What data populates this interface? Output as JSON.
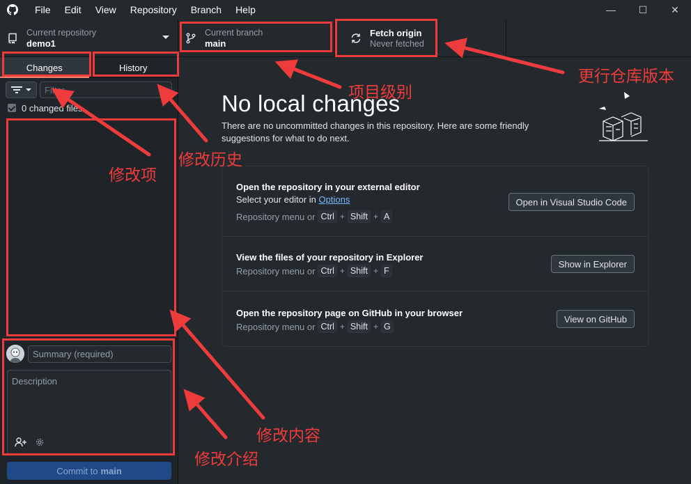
{
  "menu": [
    "File",
    "Edit",
    "View",
    "Repository",
    "Branch",
    "Help"
  ],
  "window_controls": {
    "minimize": "—",
    "maximize": "☐",
    "close": "✕"
  },
  "toolbar": {
    "repo_label": "Current repository",
    "repo_value": "demo1",
    "branch_label": "Current branch",
    "branch_value": "main",
    "fetch_title": "Fetch origin",
    "fetch_sub": "Never fetched"
  },
  "sidebar": {
    "tabs": [
      "Changes",
      "History"
    ],
    "filter_placeholder": "Filter",
    "changed_count": "0 changed files",
    "summary_placeholder": "Summary (required)",
    "description_placeholder": "Description",
    "commit_prefix": "Commit to",
    "commit_branch": "main"
  },
  "main": {
    "title": "No local changes",
    "description": "There are no uncommitted changes in this repository. Here are some friendly suggestions for what to do next.",
    "cards": [
      {
        "title": "Open the repository in your external editor",
        "line_prefix": "Select your editor in ",
        "line_link": "Options",
        "shortcut_prefix": "Repository menu or",
        "keys": [
          "Ctrl",
          "Shift",
          "A"
        ],
        "button": "Open in Visual Studio Code"
      },
      {
        "title": "View the files of your repository in Explorer",
        "shortcut_prefix": "Repository menu or",
        "keys": [
          "Ctrl",
          "Shift",
          "F"
        ],
        "button": "Show in Explorer"
      },
      {
        "title": "Open the repository page on GitHub in your browser",
        "shortcut_prefix": "Repository menu or",
        "keys": [
          "Ctrl",
          "Shift",
          "G"
        ],
        "button": "View on GitHub"
      }
    ]
  },
  "annotations": {
    "color": "#ee3b3b",
    "project_level": "项目级别",
    "update_repo": "更行仓库版本",
    "modify_history": "修改历史",
    "modify_items": "修改项",
    "modify_content": "修改内容",
    "modify_intro": "修改介绍"
  }
}
